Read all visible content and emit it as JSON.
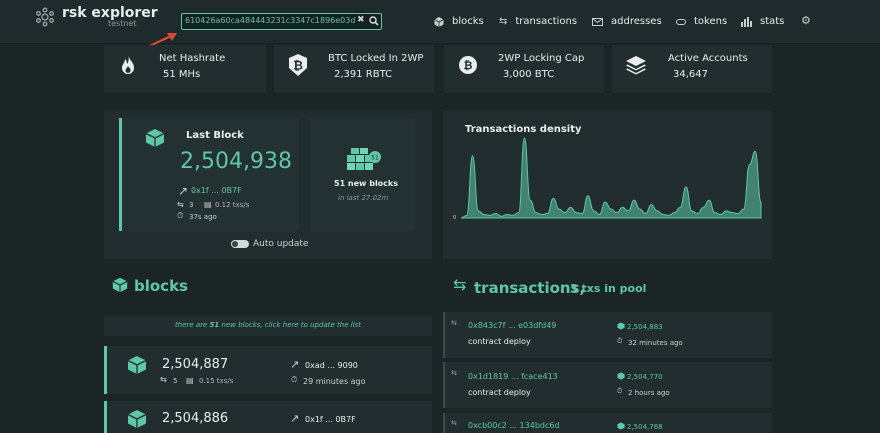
{
  "header": {
    "logo_name": "rsk explorer",
    "logo_sub": "testnet",
    "search_value": "610426a60ca484443231c3347c1896e03dfd45",
    "nav": [
      {
        "label": "blocks",
        "icon": "cubes-icon"
      },
      {
        "label": "transactions",
        "icon": "transfer-icon"
      },
      {
        "label": "addresses",
        "icon": "envelope-icon"
      },
      {
        "label": "tokens",
        "icon": "token-icon"
      },
      {
        "label": "stats",
        "icon": "bar-chart-icon"
      }
    ]
  },
  "stats": [
    {
      "label": "Net Hashrate",
      "value": "51 MHs"
    },
    {
      "label": "BTC Locked In 2WP",
      "value": "2,391 RBTC"
    },
    {
      "label": "2WP Locking Cap",
      "value": "3,000 BTC"
    },
    {
      "label": "Active Accounts",
      "value": "34,647"
    }
  ],
  "last_block": {
    "title": "Last Block",
    "number": "2,504,938",
    "miner": "0x1f ... 0B7F",
    "txs": "3",
    "txs_rate": "0.12 txs/s",
    "age": "37s ago"
  },
  "new_blocks": {
    "badge": "51",
    "label": "51 new blocks",
    "sub": "in last 27.02m"
  },
  "auto_update": "Auto update",
  "density": {
    "title": "Transactions density",
    "y_label": "0"
  },
  "chart_data": {
    "type": "area",
    "title": "Transactions density",
    "xlabel": "",
    "ylabel": "",
    "values": [
      0,
      3,
      70,
      8,
      4,
      3,
      5,
      2,
      4,
      3,
      6,
      90,
      20,
      6,
      4,
      5,
      22,
      10,
      6,
      12,
      6,
      5,
      25,
      8,
      4,
      18,
      10,
      6,
      12,
      8,
      20,
      10,
      5,
      15,
      8,
      4,
      3,
      6,
      12,
      35,
      8,
      5,
      12,
      20,
      6,
      4,
      8,
      6,
      5,
      10,
      60,
      75,
      18
    ]
  },
  "blocks": {
    "title": "blocks",
    "notice_pre": "there are ",
    "notice_count": "51",
    "notice_post": " new blocks, click here to update the list",
    "rows": [
      {
        "number": "2,504,887",
        "txs": "5",
        "rate": "0.15 txs/s",
        "miner": "0xad ... 9090",
        "age": "29 minutes ago"
      },
      {
        "number": "2,504,886",
        "txs": "",
        "rate": "",
        "miner": "0x1f ... 0B7F",
        "age": ""
      }
    ]
  },
  "transactions": {
    "title": "transactions,",
    "pool": "3 txs in pool",
    "rows": [
      {
        "hash": "0x843c7f ... e03dfd49",
        "type": "contract deploy",
        "block": "2,504,883",
        "age": "32 minutes ago"
      },
      {
        "hash": "0x1d1819 ... fcace413",
        "type": "contract deploy",
        "block": "2,504,770",
        "age": "2 hours ago"
      },
      {
        "hash": "0xcb00c2 ... 134bdc6d",
        "type": "",
        "block": "2,504,768",
        "age": ""
      }
    ]
  },
  "colors": {
    "accent": "#5cc8a7",
    "background": "#1b2526",
    "card": "#212d2e",
    "annotation": "#e0482c"
  }
}
